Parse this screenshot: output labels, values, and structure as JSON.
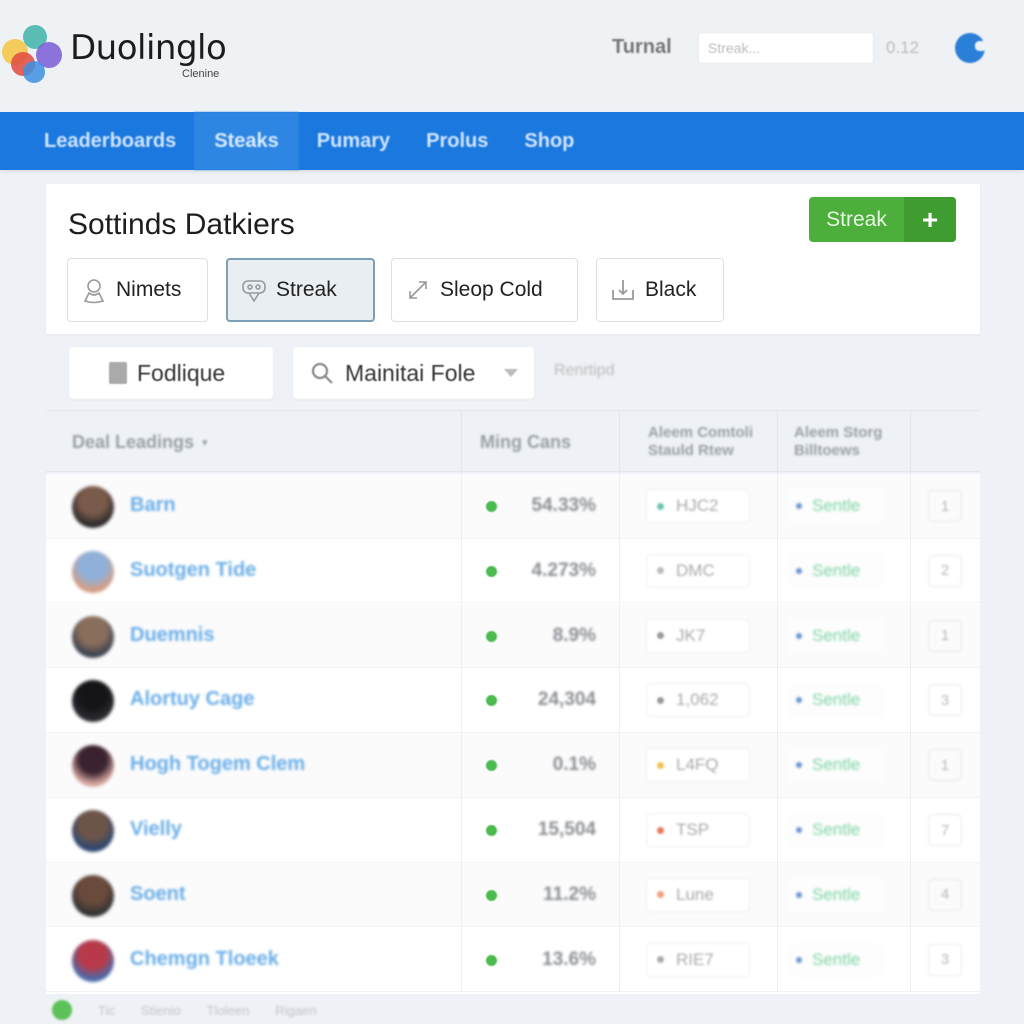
{
  "header": {
    "brand": "Duolinglo",
    "brand_sub": "Clenine",
    "label": "Turnal",
    "search_placeholder": "Streak...",
    "count": "0.12",
    "logo_colors": [
      "#f4c542",
      "#3fb3a9",
      "#7a5cd6",
      "#e04a3f",
      "#3d8fe0"
    ],
    "avatar_color": "#2a7fd8"
  },
  "nav": {
    "tabs": [
      {
        "label": "Leaderboards",
        "active": false
      },
      {
        "label": "Steaks",
        "active": true
      },
      {
        "label": "Pumary",
        "active": false
      },
      {
        "label": "Prolus",
        "active": false
      },
      {
        "label": "Shop",
        "active": false
      }
    ],
    "color": "#1a78de"
  },
  "card": {
    "title": "Sottinds Datkiers",
    "primary_button": {
      "label": "Streak",
      "icon": "plus-icon",
      "color": "#4cae3b"
    },
    "chips": [
      {
        "label": "Nimets",
        "icon": "user-icon",
        "active": false
      },
      {
        "label": "Streak",
        "icon": "badge-icon",
        "active": true
      },
      {
        "label": "Sleop Cold",
        "icon": "expand-arrows-icon",
        "active": false
      },
      {
        "label": "Black",
        "icon": "download-tray-icon",
        "active": false
      }
    ]
  },
  "filters": {
    "button_label": "Fodlique",
    "select_value": "Mainitai Fole",
    "extra_label": "Renrtipd"
  },
  "table": {
    "headers": [
      "Deal Leadings",
      "Ming Cans",
      "Aleem Comtoli Stauld Rtew",
      "Aleem Storg Billtoews",
      ""
    ],
    "rows": [
      {
        "name": "Barn",
        "value": "54.33%",
        "code": "HJC2",
        "code_dot": "#6cc3b0",
        "status": "Sentle",
        "rank": "1",
        "avatar": [
          "#7a5a4a",
          "#2c2c2c"
        ]
      },
      {
        "name": "Suotgen Tide",
        "value": "4.273%",
        "code": "DMC",
        "code_dot": "#bbbbbb",
        "status": "Sentle",
        "rank": "2",
        "avatar": [
          "#8fb0d8",
          "#d49d84"
        ]
      },
      {
        "name": "Duemnis",
        "value": "8.9%",
        "code": "JK7",
        "code_dot": "#999999",
        "status": "Sentle",
        "rank": "1",
        "avatar": [
          "#8a6e5c",
          "#3e4450"
        ]
      },
      {
        "name": "Alortuy Cage",
        "value": "24,304",
        "code": "1,062",
        "code_dot": "#999999",
        "status": "Sentle",
        "rank": "3",
        "avatar": [
          "#151518",
          "#2a2a30"
        ]
      },
      {
        "name": "Hogh Togem Clem",
        "value": "0.1%",
        "code": "L4FQ",
        "code_dot": "#f2c14e",
        "status": "Sentle",
        "rank": "1",
        "avatar": [
          "#3a2230",
          "#d8a8a0"
        ]
      },
      {
        "name": "Vielly",
        "value": "15,504",
        "code": "TSP",
        "code_dot": "#e8775a",
        "status": "Sentle",
        "rank": "7",
        "avatar": [
          "#6d5448",
          "#2e4870"
        ]
      },
      {
        "name": "Soent",
        "value": "11.2%",
        "code": "Lune",
        "code_dot": "#f0a07a",
        "status": "Sentle",
        "rank": "4",
        "avatar": [
          "#6a4a3c",
          "#333333"
        ]
      },
      {
        "name": "Chemgn Tloeek",
        "value": "13.6%",
        "code": "RIE7",
        "code_dot": "#aaaaaa",
        "status": "Sentle",
        "rank": "3",
        "avatar": [
          "#b83a4a",
          "#4a6aa8"
        ]
      }
    ]
  },
  "footer": {
    "items": [
      "Tic",
      "Stienio",
      "Tloleen",
      "Rigaen"
    ]
  }
}
